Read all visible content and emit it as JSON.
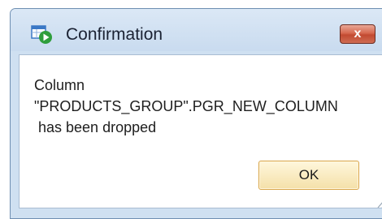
{
  "dialog": {
    "title": "Confirmation",
    "close_label": "x",
    "message": "Column\n\"PRODUCTS_GROUP\".PGR_NEW_COLUMN\n has been dropped",
    "ok_label": "OK"
  },
  "icons": {
    "app": "sql-developer-icon",
    "close": "close-icon",
    "grip": "resize-grip-icon"
  },
  "colors": {
    "frame": "#cfe0f1",
    "close_button": "#c24a31",
    "ok_border": "#d9a64a",
    "icon_green": "#2f9e3c",
    "icon_blue": "#3a78c6"
  }
}
